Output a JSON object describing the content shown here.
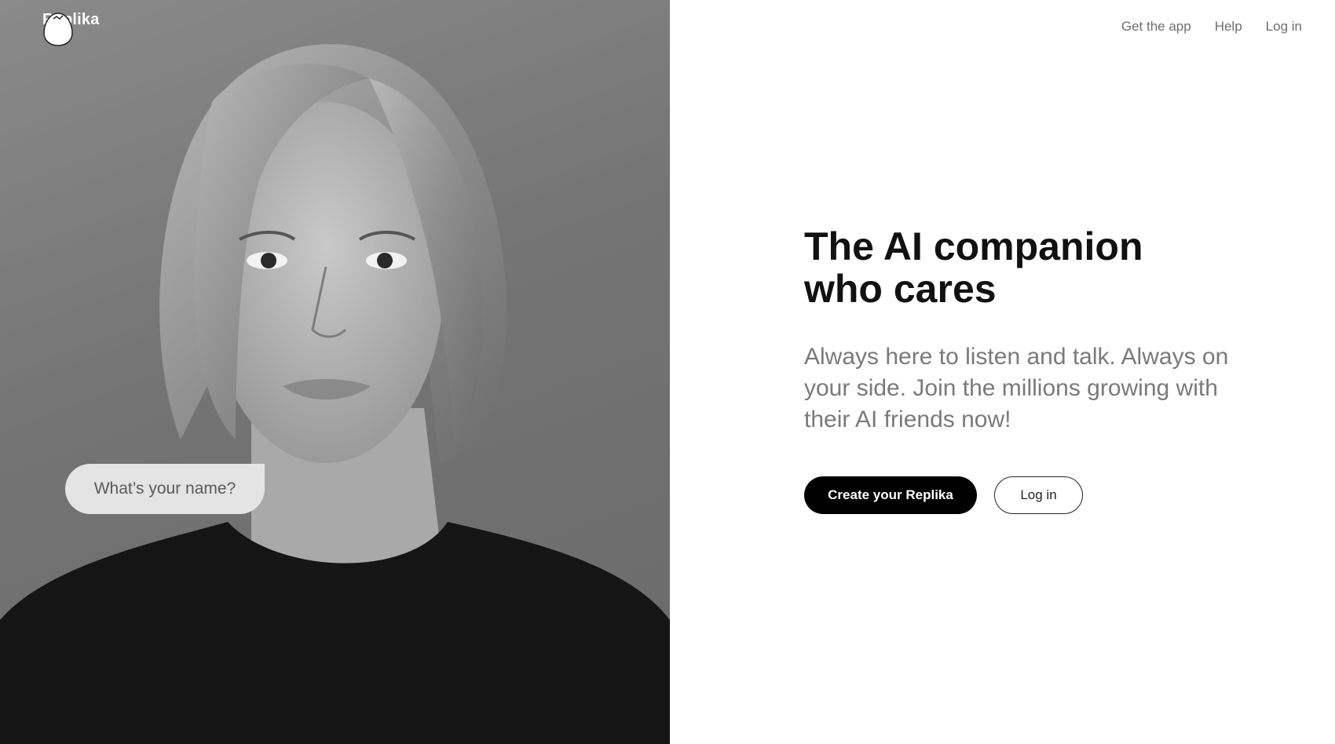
{
  "brand": {
    "name": "Replika",
    "logo_icon": "egg-logo-icon"
  },
  "nav": {
    "items": [
      "Get the app",
      "Help",
      "Log in"
    ]
  },
  "hero": {
    "chat_bubble": "What’s your name?",
    "headline": "The AI companion who cares",
    "subtext": "Always here to listen and talk. Always on your side. Join the millions growing with their AI friends now!",
    "primary_cta": "Create your Replika",
    "secondary_cta": "Log in"
  },
  "colors": {
    "primary_button": "#000000",
    "heading": "#111111",
    "body_text": "#7a7a7a",
    "nav_text": "#6e6e6e"
  }
}
